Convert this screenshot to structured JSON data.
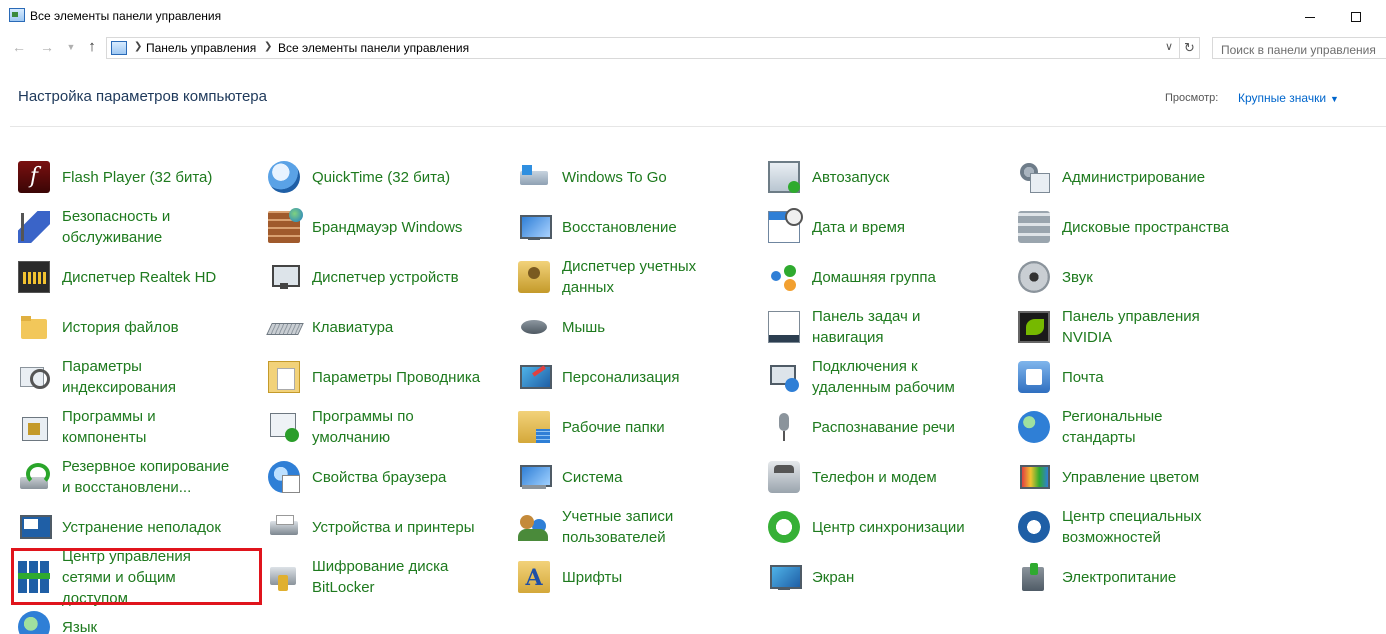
{
  "window": {
    "title": "Все элементы панели управления"
  },
  "address_bar": {
    "crumbs": [
      "Панель управления",
      "Все элементы панели управления"
    ],
    "search_placeholder": "Поиск в панели управления"
  },
  "header": {
    "title": "Настройка параметров компьютера",
    "view_label": "Просмотр:",
    "view_value": "Крупные значки"
  },
  "items": [
    {
      "label": "Flash Player (32 бита)",
      "icon": "flash-player-icon"
    },
    {
      "label": "QuickTime (32 бита)",
      "icon": "quicktime-icon"
    },
    {
      "label": "Windows To Go",
      "icon": "usb-drive-icon"
    },
    {
      "label": "Автозапуск",
      "icon": "autoplay-icon"
    },
    {
      "label": "Администрирование",
      "icon": "admin-tools-icon"
    },
    {
      "label": "Безопасность и обслуживание",
      "icon": "security-flag-icon"
    },
    {
      "label": "Брандмауэр Windows",
      "icon": "firewall-icon"
    },
    {
      "label": "Восстановление",
      "icon": "recovery-icon"
    },
    {
      "label": "Дата и время",
      "icon": "date-time-icon"
    },
    {
      "label": "Дисковые пространства",
      "icon": "storage-spaces-icon"
    },
    {
      "label": "Диспетчер Realtek HD",
      "icon": "realtek-icon"
    },
    {
      "label": "Диспетчер устройств",
      "icon": "device-manager-icon"
    },
    {
      "label": "Диспетчер учетных данных",
      "icon": "credential-manager-icon"
    },
    {
      "label": "Домашняя группа",
      "icon": "homegroup-icon"
    },
    {
      "label": "Звук",
      "icon": "sound-icon"
    },
    {
      "label": "История файлов",
      "icon": "file-history-icon"
    },
    {
      "label": "Клавиатура",
      "icon": "keyboard-icon"
    },
    {
      "label": "Мышь",
      "icon": "mouse-icon"
    },
    {
      "label": "Панель задач и навигация",
      "icon": "taskbar-icon"
    },
    {
      "label": "Панель управления NVIDIA",
      "icon": "nvidia-icon"
    },
    {
      "label": "Параметры индексирования",
      "icon": "indexing-icon"
    },
    {
      "label": "Параметры Проводника",
      "icon": "explorer-options-icon"
    },
    {
      "label": "Персонализация",
      "icon": "personalization-icon"
    },
    {
      "label": "Подключения к удаленным рабочим",
      "icon": "remote-desktop-icon"
    },
    {
      "label": "Почта",
      "icon": "mail-icon"
    },
    {
      "label": "Программы и компоненты",
      "icon": "programs-icon"
    },
    {
      "label": "Программы по умолчанию",
      "icon": "default-programs-icon"
    },
    {
      "label": "Рабочие папки",
      "icon": "work-folders-icon"
    },
    {
      "label": "Распознавание речи",
      "icon": "microphone-icon"
    },
    {
      "label": "Региональные стандарты",
      "icon": "region-globe-icon"
    },
    {
      "label": "Резервное копирование и восстановлени...",
      "icon": "backup-icon"
    },
    {
      "label": "Свойства браузера",
      "icon": "internet-options-icon"
    },
    {
      "label": "Система",
      "icon": "system-icon"
    },
    {
      "label": "Телефон и модем",
      "icon": "phone-modem-icon"
    },
    {
      "label": "Управление цветом",
      "icon": "color-management-icon"
    },
    {
      "label": "Устранение неполадок",
      "icon": "troubleshooting-icon"
    },
    {
      "label": "Устройства и принтеры",
      "icon": "printer-icon"
    },
    {
      "label": "Учетные записи пользователей",
      "icon": "user-accounts-icon"
    },
    {
      "label": "Центр синхронизации",
      "icon": "sync-center-icon"
    },
    {
      "label": "Центр специальных возможностей",
      "icon": "ease-of-access-icon"
    },
    {
      "label": "Центр управления сетями и общим доступом",
      "icon": "network-center-icon"
    },
    {
      "label": "Шифрование диска BitLocker",
      "icon": "bitlocker-icon"
    },
    {
      "label": "Шрифты",
      "icon": "fonts-icon"
    },
    {
      "label": "Экран",
      "icon": "display-icon"
    },
    {
      "label": "Электропитание",
      "icon": "power-icon"
    },
    {
      "label": "Язык",
      "icon": "language-icon"
    }
  ],
  "highlight_color": "#e0141c"
}
